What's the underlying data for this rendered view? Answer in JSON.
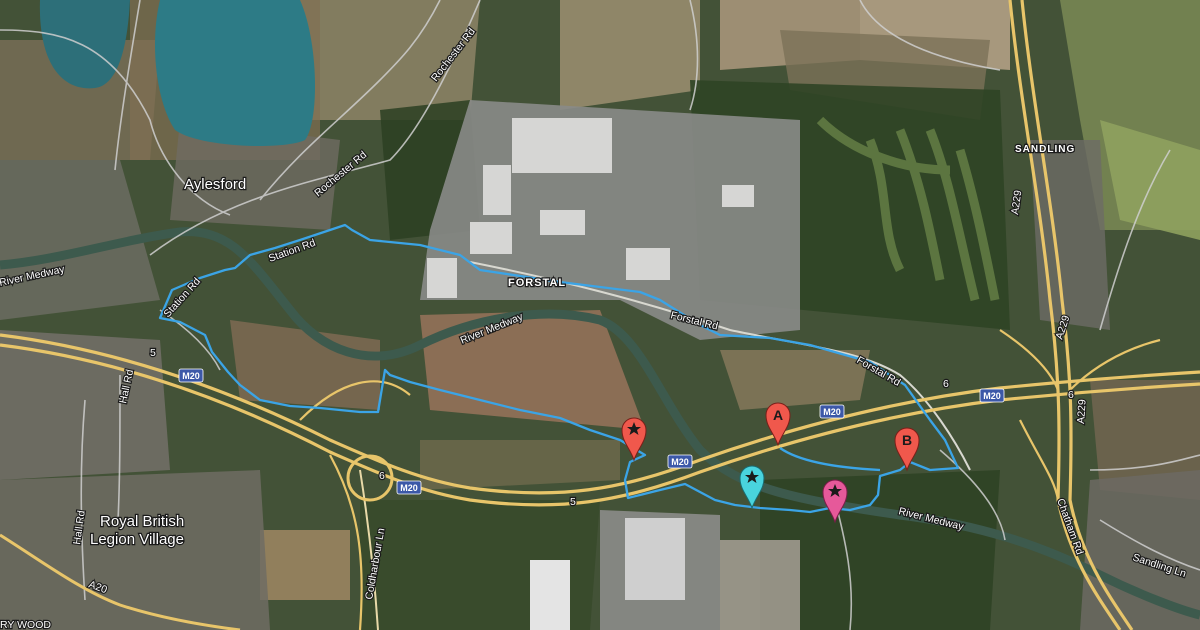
{
  "map": {
    "places": {
      "aylesford": "Aylesford",
      "forstal": "FORSTAL",
      "sandling": "SANDLING",
      "royal_british_1": "Royal British",
      "royal_british_2": "Legion Village",
      "bywood": "RY WOOD"
    },
    "roads": {
      "rochester_rd_1": "Rochester Rd",
      "rochester_rd_2": "Rochester Rd",
      "station_rd_1": "Station Rd",
      "station_rd_2": "Station Rd",
      "forstal_rd_1": "Forstal Rd",
      "forstal_rd_2": "Forstal Rd",
      "hall_rd_1": "Hall Rd",
      "hall_rd_2": "Hall Rd",
      "coldharbour_ln": "Coldharbour Ln",
      "chatham_rd": "Chatham Rd",
      "sandling_ln": "Sandling Ln",
      "a20": "A20",
      "a229_1": "A229",
      "a229_2": "A229",
      "a229_3": "A229"
    },
    "water": {
      "river_medway_1": "River Medway",
      "river_medway_2": "River Medway",
      "river_medway_3": "River Medway"
    },
    "shields": {
      "m20_1": "M20",
      "m20_2": "M20",
      "m20_3": "M20",
      "m20_4": "M20",
      "m20_5": "M20"
    },
    "junctions": {
      "j5_1": "5",
      "j5_2": "5",
      "j6_1": "6",
      "j6_2": "6",
      "j6_3": "6"
    },
    "markers": {
      "a": "A",
      "b": "B"
    },
    "colors": {
      "route": "#3ba4e6",
      "motorway": "#e8c56a",
      "marker_red": "#f0584c",
      "marker_cyan": "#49d4de",
      "marker_pink": "#e6599a",
      "shield": "#3c58a8",
      "lake": "#2a7a86"
    }
  }
}
